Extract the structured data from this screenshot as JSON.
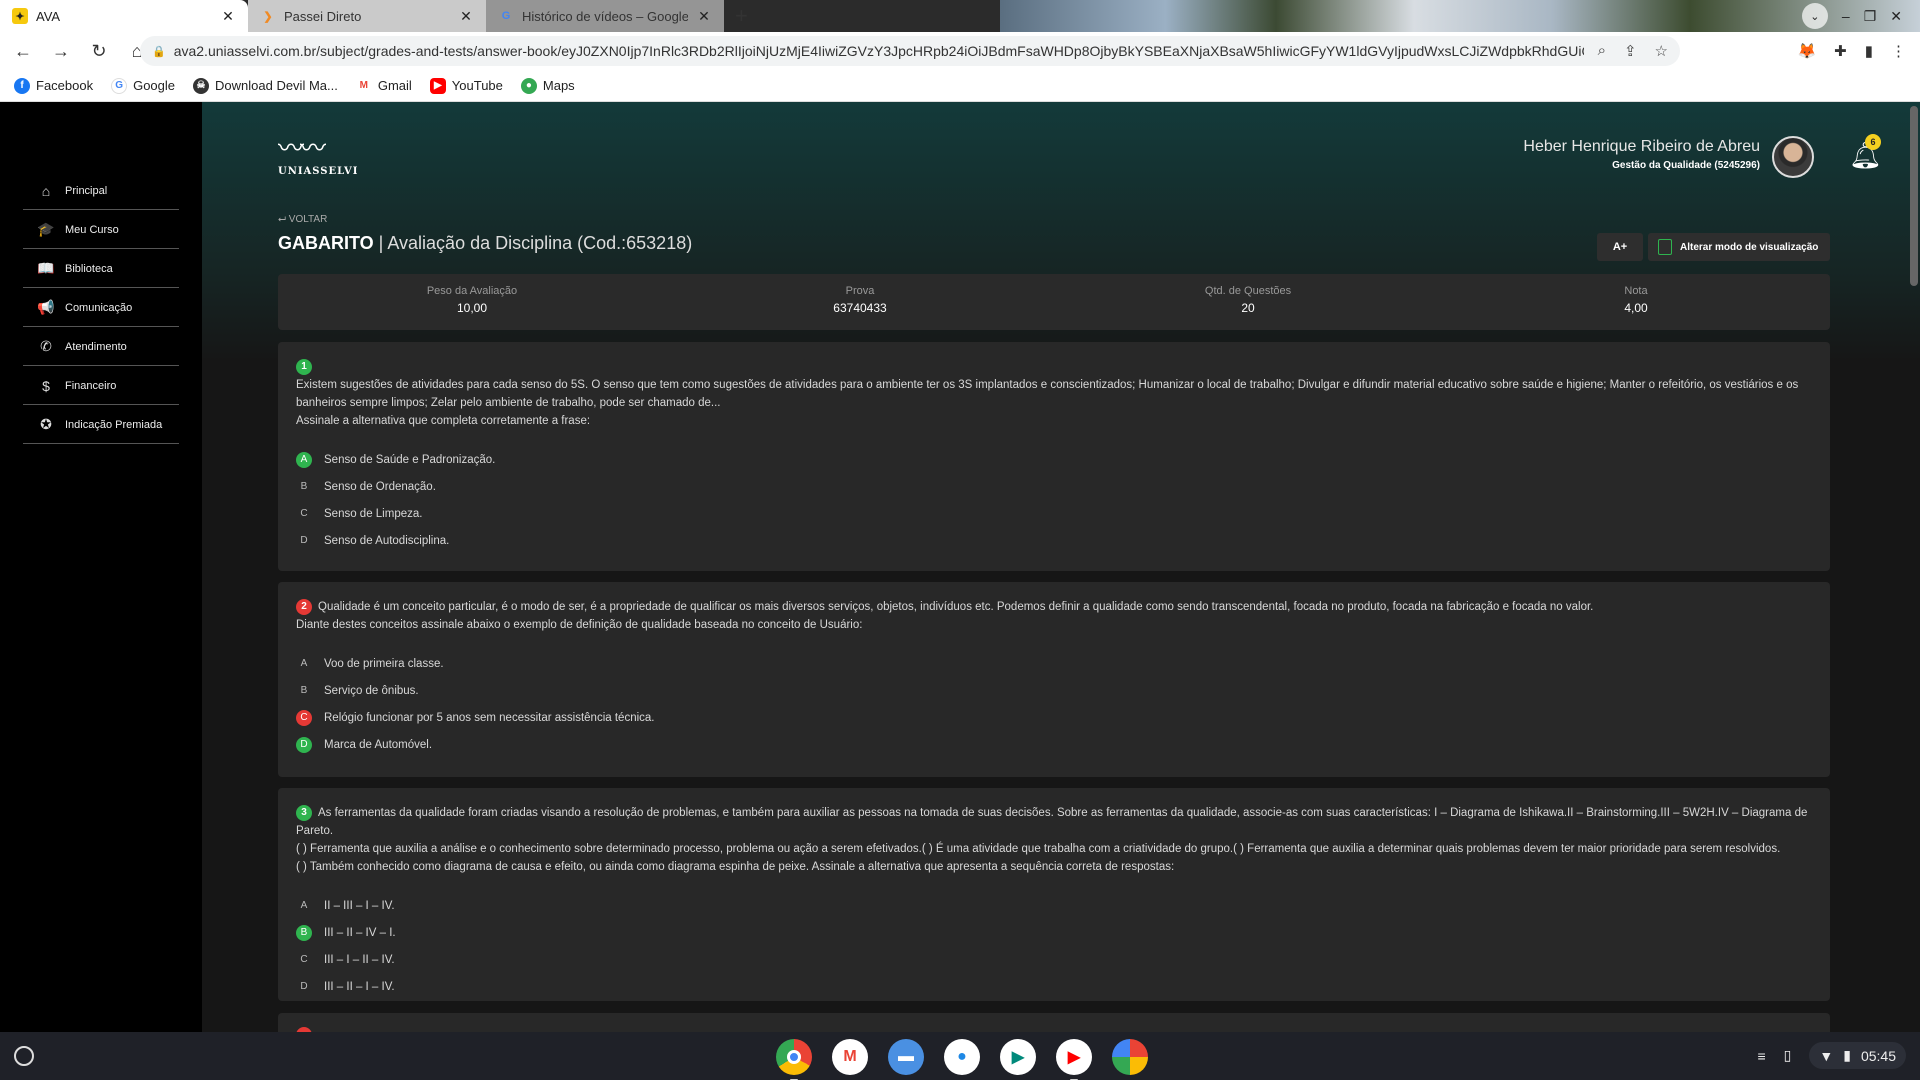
{
  "browser": {
    "tabs": [
      {
        "title": "AVA",
        "active": true
      },
      {
        "title": "Passei Direto",
        "active": false
      },
      {
        "title": "Histórico de vídeos – Google",
        "active": false
      }
    ],
    "url": "ava2.uniasselvi.com.br/subject/grades-and-tests/answer-book/eyJ0ZXN0Ijp7InRlc3RDb2RlIjoiNjUzMjE4IiwiZGVzY3JpcHRpb24iOiJBdmFsaWHDp8OjbyBkYSBEaXNjaXBsaW5hIiwicGFyYW1ldGVyIjpudWxsLCJiZWdpbkRhdGUiOiIyMDIzLTA0L...",
    "bookmarks": [
      "Facebook",
      "Google",
      "Download Devil Ma...",
      "Gmail",
      "YouTube",
      "Maps"
    ]
  },
  "sidebar": {
    "items": [
      {
        "label": "Principal",
        "icon": "home-icon"
      },
      {
        "label": "Meu Curso",
        "icon": "graduation-cap-icon"
      },
      {
        "label": "Biblioteca",
        "icon": "book-icon"
      },
      {
        "label": "Comunicação",
        "icon": "megaphone-icon"
      },
      {
        "label": "Atendimento",
        "icon": "phone-icon"
      },
      {
        "label": "Financeiro",
        "icon": "dollar-icon"
      },
      {
        "label": "Indicação Premiada",
        "icon": "gift-icon"
      }
    ]
  },
  "header": {
    "logo_text": "UNIASSELVI",
    "user_name": "Heber Henrique Ribeiro de Abreu",
    "course": "Gestão da Qualidade (5245296)",
    "notifications": "6"
  },
  "page": {
    "back_label": "VOLTAR",
    "title_bold": "GABARITO",
    "title_rest": " | Avaliação da Disciplina (Cod.:653218)",
    "font_button": "A+",
    "view_button": "Alterar modo de visualização"
  },
  "stats": [
    {
      "label": "Peso da Avaliação",
      "value": "10,00"
    },
    {
      "label": "Prova",
      "value": "63740433"
    },
    {
      "label": "Qtd. de Questões",
      "value": "20"
    },
    {
      "label": "Nota",
      "value": "4,00"
    }
  ],
  "questions": [
    {
      "number": "1",
      "status": "correct",
      "lines": [
        "Existem sugestões de atividades para cada senso do 5S. O senso que tem como sugestões de atividades para o ambiente ter os 3S implantados e conscientizados; Humanizar o local de trabalho; Divulgar e difundir material educativo sobre saúde e higiene; Manter o refeitório, os vestiários e os banheiros sempre limpos; Zelar pelo ambiente de trabalho, pode ser chamado de...",
        " Assinale a alternativa que completa corretamente a frase:"
      ],
      "alternatives": [
        {
          "letter": "A",
          "text": "Senso de Saúde e Padronização."
        },
        {
          "letter": "B",
          "text": "Senso de Ordenação."
        },
        {
          "letter": "C",
          "text": "Senso de Limpeza."
        },
        {
          "letter": "D",
          "text": "Senso de Autodisciplina."
        }
      ]
    },
    {
      "number": "2",
      "status": "wrong",
      "lines": [
        "Qualidade é um conceito particular, é o modo de ser, é a propriedade de qualificar os mais diversos serviços, objetos, indivíduos etc. Podemos definir a qualidade como sendo transcendental, focada no produto, focada na fabricação e focada no valor.",
        "Diante destes conceitos assinale abaixo o exemplo de definição de qualidade baseada no conceito de Usuário:"
      ],
      "alternatives": [
        {
          "letter": "A",
          "text": "Voo de primeira classe."
        },
        {
          "letter": "B",
          "text": "Serviço de ônibus."
        },
        {
          "letter": "C",
          "text": "Relógio funcionar por 5 anos sem necessitar assistência técnica."
        },
        {
          "letter": "D",
          "text": "Marca de Automóvel."
        }
      ]
    },
    {
      "number": "3",
      "status": "correct",
      "lines": [
        "As ferramentas da qualidade foram criadas visando a resolução de problemas, e também para auxiliar as pessoas na tomada de suas decisões. Sobre as ferramentas da qualidade, associe-as com suas características: I – Diagrama de Ishikawa.II – Brainstorming.III – 5W2H.IV – Diagrama de Pareto.",
        "(   ) Ferramenta que auxilia a análise e o conhecimento sobre determinado processo, problema ou ação a serem efetivados.(   ) É uma atividade que trabalha com a criatividade do grupo.(   ) Ferramenta que auxilia a determinar quais problemas devem ter maior prioridade para serem resolvidos.",
        "(   ) Também conhecido como diagrama de causa e efeito, ou ainda como diagrama espinha de peixe. Assinale a alternativa que apresenta a sequência correta de respostas:"
      ],
      "alternatives": [
        {
          "letter": "A",
          "text": "II – III – I – IV."
        },
        {
          "letter": "B",
          "text": "III – II – IV – I."
        },
        {
          "letter": "C",
          "text": "III – I – II – IV."
        },
        {
          "letter": "D",
          "text": "III – II – I – IV."
        }
      ]
    }
  ],
  "shelf": {
    "apps": [
      "chrome-icon",
      "gmail-icon",
      "files-icon",
      "chat-icon",
      "meet-icon",
      "youtube-icon",
      "photos-icon"
    ],
    "time": "05:45"
  },
  "colors": {
    "correct": "#2fb44f",
    "wrong": "#e53935",
    "accent_badge": "#f5d020"
  }
}
